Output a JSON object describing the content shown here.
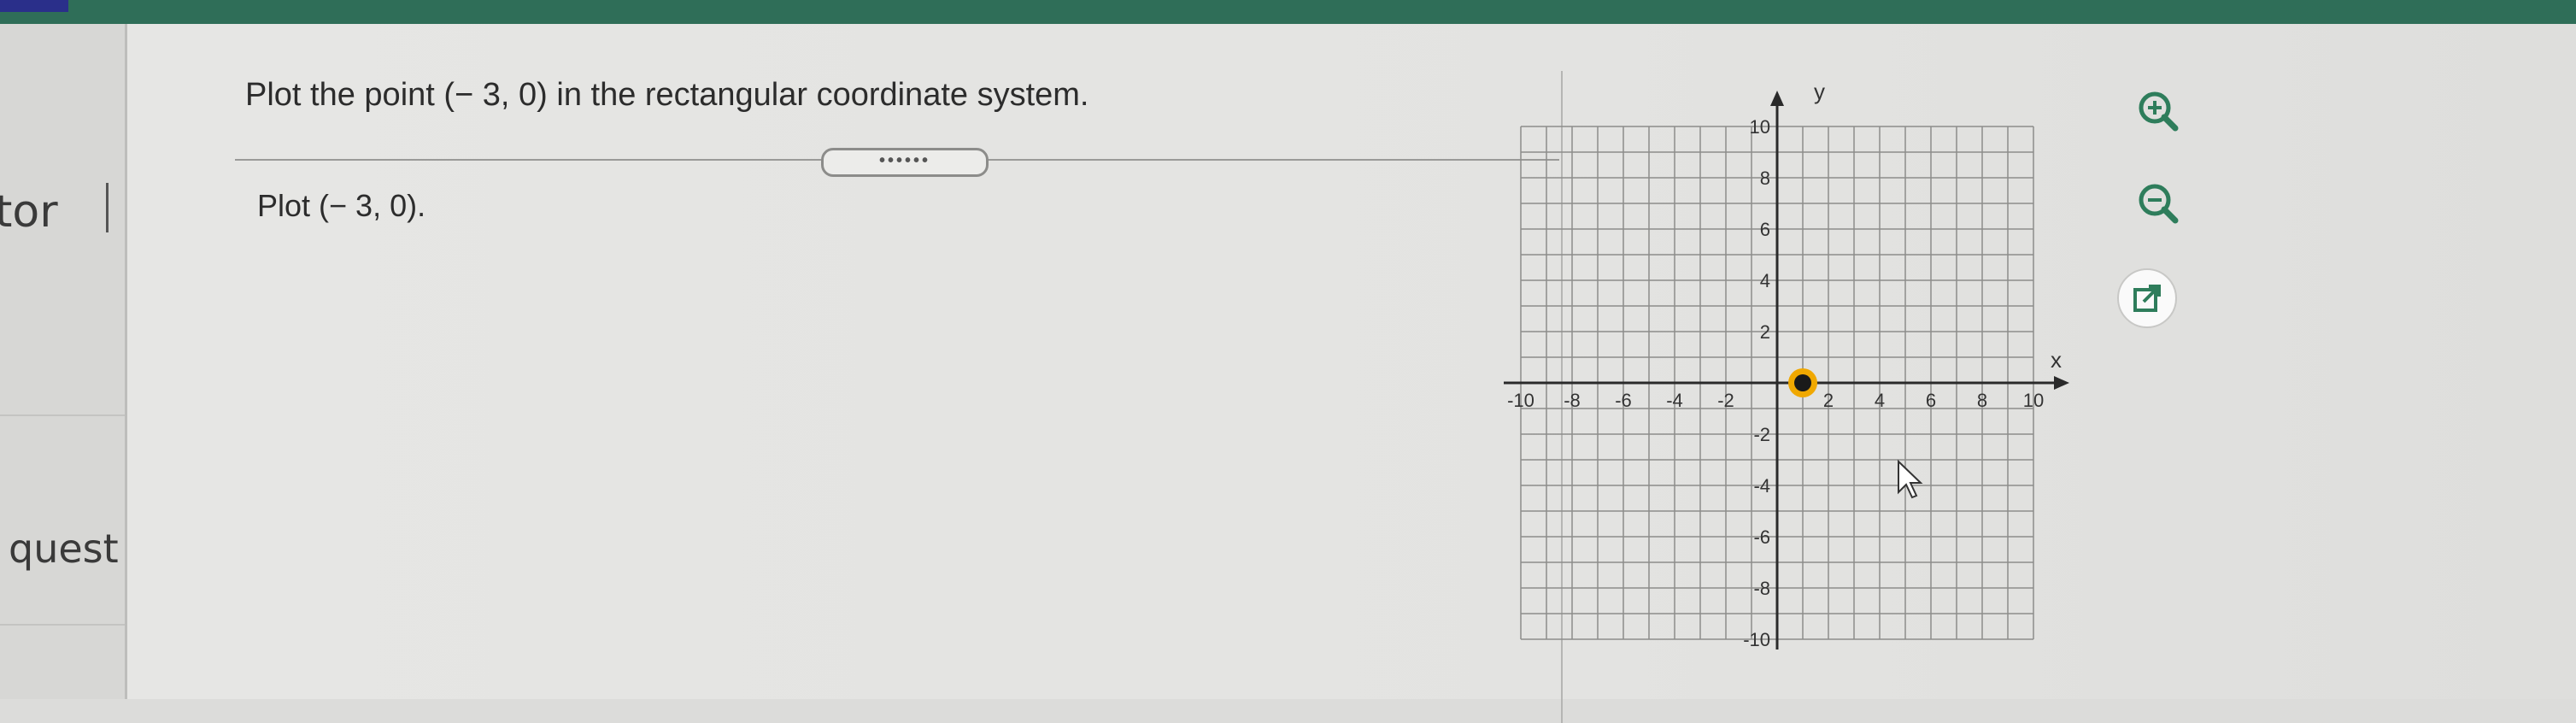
{
  "sidebar": {
    "partial_label_1": "tor",
    "partial_label_2": "quest"
  },
  "question": {
    "prompt": "Plot the point (− 3, 0) in the rectangular coordinate system.",
    "expand_label": "••••••",
    "instruction": "Plot (− 3, 0)."
  },
  "graph": {
    "x_axis_label": "x",
    "y_axis_label": "y",
    "x_range": [
      -10,
      10
    ],
    "y_range": [
      -10,
      10
    ],
    "grid_step": 1,
    "x_tick_labels": [
      "-10",
      "-8",
      "-6",
      "-4",
      "-2",
      "2",
      "4",
      "6",
      "8",
      "10"
    ],
    "y_tick_labels": [
      "10",
      "8",
      "6",
      "4",
      "2",
      "-2",
      "-4",
      "-6",
      "-8",
      "-10"
    ],
    "plotted_point": {
      "x": 1,
      "y": 0
    }
  },
  "tools": {
    "zoom_in": "zoom-in-icon",
    "zoom_out": "zoom-out-icon",
    "popout": "popout-icon"
  },
  "colors": {
    "top_bar": "#2f6e58",
    "point_fill": "#1a1a1a",
    "point_ring": "#f0a800",
    "tool_icon": "#2e7d5b"
  }
}
